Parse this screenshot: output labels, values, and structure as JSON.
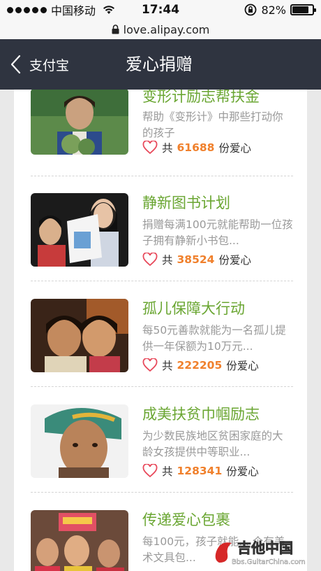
{
  "status_bar": {
    "carrier": "中国移动",
    "time": "17:44",
    "battery_percent": "82%",
    "battery_level": 0.82
  },
  "url_bar": {
    "url": "love.alipay.com"
  },
  "nav": {
    "back_label": "支付宝",
    "title": "爱心捐赠"
  },
  "projects": [
    {
      "title": "变形计励志帮扶金",
      "desc": "帮助《变形计》中那些打动你的孩子",
      "prefix": "共",
      "count": "61688",
      "suffix": "份爱心"
    },
    {
      "title": "静新图书计划",
      "desc": "捐赠每满100元就能帮助一位孩子拥有静新小书包...",
      "prefix": "共",
      "count": "38524",
      "suffix": "份爱心"
    },
    {
      "title": "孤儿保障大行动",
      "desc": "每50元善款就能为一名孤儿提供一年保额为10万元...",
      "prefix": "共",
      "count": "222205",
      "suffix": "份爱心"
    },
    {
      "title": "成美扶贫巾帼励志",
      "desc": "为少数民族地区贫困家庭的大龄女孩提供中等职业...",
      "prefix": "共",
      "count": "128341",
      "suffix": "份爱心"
    },
    {
      "title": "传递爱心包裹",
      "desc": "每100元，孩子就能... 个有美术文具包...",
      "prefix": "",
      "count": "",
      "suffix": ""
    }
  ],
  "watermark": {
    "text": "吉他中国",
    "url": "Bbs.GuitarChina.com"
  },
  "colors": {
    "nav_bg": "#2f3440",
    "title_green": "#6aa632",
    "count_orange": "#f0802c",
    "heart_red": "#e8495b"
  }
}
